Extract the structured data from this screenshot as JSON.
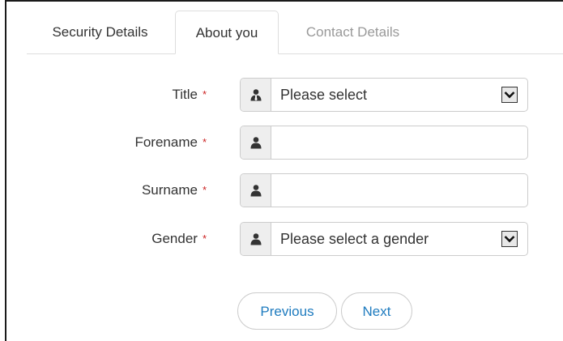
{
  "tabs": [
    {
      "label": "Security Details",
      "state": "inactive"
    },
    {
      "label": "About you",
      "state": "active"
    },
    {
      "label": "Contact Details",
      "state": "disabled"
    }
  ],
  "required_marker": "*",
  "fields": {
    "title": {
      "label": "Title",
      "value": "Please select",
      "icon": "user-tie-icon"
    },
    "forename": {
      "label": "Forename",
      "value": "",
      "placeholder": "",
      "icon": "user-icon"
    },
    "surname": {
      "label": "Surname",
      "value": "",
      "placeholder": "",
      "icon": "user-icon"
    },
    "gender": {
      "label": "Gender",
      "value": "Please select a gender",
      "icon": "user-icon"
    }
  },
  "buttons": {
    "previous": "Previous",
    "next": "Next"
  },
  "colors": {
    "link": "#1e7bbf",
    "required": "#cc2222",
    "addon_bg": "#eeeeee",
    "border": "#cccccc"
  }
}
